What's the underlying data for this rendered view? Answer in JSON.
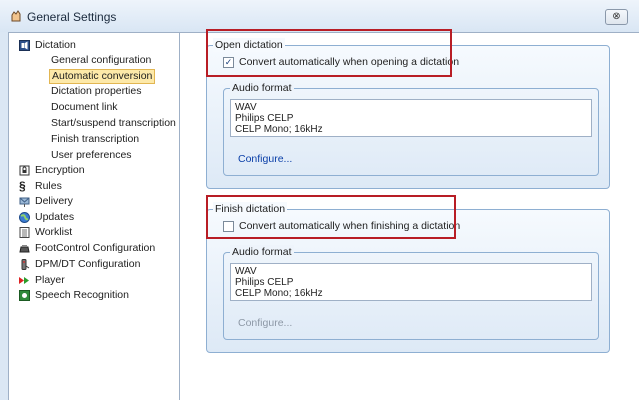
{
  "window": {
    "title": "General Settings",
    "close_label": "⊗"
  },
  "tree": {
    "items": [
      {
        "label": "Dictation",
        "icon": "dictation-icon"
      },
      {
        "label": "Encryption",
        "icon": "lock-icon"
      },
      {
        "label": "Rules",
        "icon": "section-icon"
      },
      {
        "label": "Delivery",
        "icon": "mailbox-icon"
      },
      {
        "label": "Updates",
        "icon": "globe-icon"
      },
      {
        "label": "Worklist",
        "icon": "list-icon"
      },
      {
        "label": "FootControl Configuration",
        "icon": "footcontrol-icon"
      },
      {
        "label": "DPM/DT Configuration",
        "icon": "recorder-icon"
      },
      {
        "label": "Player",
        "icon": "player-icon"
      },
      {
        "label": "Speech Recognition",
        "icon": "speech-icon"
      }
    ],
    "dictation_children": [
      "General configuration",
      "Automatic conversion",
      "Dictation properties",
      "Document link",
      "Start/suspend transcription",
      "Finish transcription",
      "User preferences"
    ],
    "selected": "Automatic conversion"
  },
  "open_dictation": {
    "legend": "Open dictation",
    "checkbox_label": "Convert automatically when opening a dictation",
    "checked": true,
    "audio_format": {
      "legend": "Audio format",
      "lines": [
        "WAV",
        "Philips CELP",
        "CELP Mono; 16kHz"
      ],
      "configure_label": "Configure...",
      "configure_enabled": true
    }
  },
  "finish_dictation": {
    "legend": "Finish dictation",
    "checkbox_label": "Convert automatically when finishing a dictation",
    "checked": false,
    "audio_format": {
      "legend": "Audio format",
      "lines": [
        "WAV",
        "Philips CELP",
        "CELP Mono; 16kHz"
      ],
      "configure_label": "Configure...",
      "configure_enabled": false
    }
  },
  "colors": {
    "highlight": "#b81d25",
    "selection": "#fde9a9",
    "link": "#0a3fa8"
  }
}
